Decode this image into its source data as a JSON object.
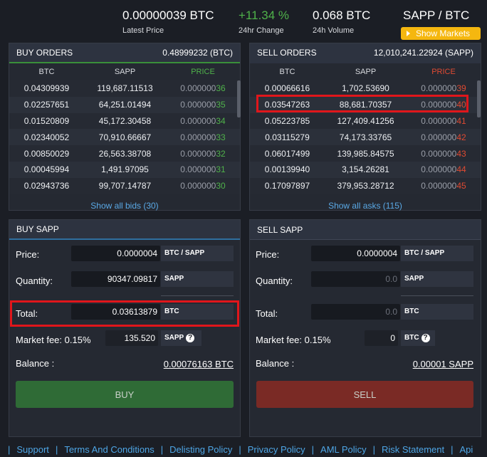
{
  "ticker": {
    "latest_price": "0.00000039 BTC",
    "latest_price_label": "Latest Price",
    "change": "+11.34 %",
    "change_label": "24hr Change",
    "volume": "0.068 BTC",
    "volume_label": "24h Volume",
    "pair": "SAPP / BTC",
    "show_markets": "Show Markets"
  },
  "buy_orders": {
    "title": "BUY ORDERS",
    "total": "0.48999232 (BTC)",
    "columns": [
      "BTC",
      "SAPP",
      "PRICE"
    ],
    "rows": [
      {
        "btc": "0.04309939",
        "sapp": "119,687.11513",
        "price_dim": "0.000000",
        "price_hl": "36"
      },
      {
        "btc": "0.02257651",
        "sapp": "64,251.01494",
        "price_dim": "0.000000",
        "price_hl": "35"
      },
      {
        "btc": "0.01520809",
        "sapp": "45,172.30458",
        "price_dim": "0.000000",
        "price_hl": "34"
      },
      {
        "btc": "0.02340052",
        "sapp": "70,910.66667",
        "price_dim": "0.000000",
        "price_hl": "33"
      },
      {
        "btc": "0.00850029",
        "sapp": "26,563.38708",
        "price_dim": "0.000000",
        "price_hl": "32"
      },
      {
        "btc": "0.00045994",
        "sapp": "1,491.97095",
        "price_dim": "0.000000",
        "price_hl": "31"
      },
      {
        "btc": "0.02943736",
        "sapp": "99,707.14787",
        "price_dim": "0.000000",
        "price_hl": "30"
      }
    ],
    "show_all": "Show all bids (30)",
    "accent": "#4fb24a"
  },
  "sell_orders": {
    "title": "SELL ORDERS",
    "total": "12,010,241.22924 (SAPP)",
    "columns": [
      "BTC",
      "SAPP",
      "PRICE"
    ],
    "rows": [
      {
        "btc": "0.00066616",
        "sapp": "1,702.53690",
        "price_dim": "0.000000",
        "price_hl": "39"
      },
      {
        "btc": "0.03547263",
        "sapp": "88,681.70357",
        "price_dim": "0.000000",
        "price_hl": "40"
      },
      {
        "btc": "0.05223785",
        "sapp": "127,409.41256",
        "price_dim": "0.000000",
        "price_hl": "41"
      },
      {
        "btc": "0.03115279",
        "sapp": "74,173.33765",
        "price_dim": "0.000000",
        "price_hl": "42"
      },
      {
        "btc": "0.06017499",
        "sapp": "139,985.84575",
        "price_dim": "0.000000",
        "price_hl": "43"
      },
      {
        "btc": "0.00139940",
        "sapp": "3,154.26281",
        "price_dim": "0.000000",
        "price_hl": "44"
      },
      {
        "btc": "0.17097897",
        "sapp": "379,953.28712",
        "price_dim": "0.000000",
        "price_hl": "45"
      }
    ],
    "show_all": "Show all asks (115)",
    "accent": "#e04a32"
  },
  "buy_form": {
    "title": "BUY SAPP",
    "price_label": "Price:",
    "price_value": "0.0000004",
    "price_unit": "BTC / SAPP",
    "quantity_label": "Quantity:",
    "quantity_value": "90347.09817",
    "quantity_unit": "SAPP",
    "total_label": "Total:",
    "total_value": "0.03613879",
    "total_unit": "BTC",
    "fee_label": "Market fee: 0.15%",
    "fee_value": "135.520",
    "fee_unit": "SAPP",
    "balance_label": "Balance :",
    "balance_value": "0.00076163 BTC",
    "button": "BUY"
  },
  "sell_form": {
    "title": "SELL SAPP",
    "price_label": "Price:",
    "price_value": "0.0000004",
    "price_unit": "BTC / SAPP",
    "quantity_label": "Quantity:",
    "quantity_placeholder": "0.0",
    "quantity_unit": "SAPP",
    "total_label": "Total:",
    "total_placeholder": "0.0",
    "total_unit": "BTC",
    "fee_label": "Market fee: 0.15%",
    "fee_value": "0",
    "fee_unit": "BTC",
    "balance_label": "Balance :",
    "balance_value": "0.00001 SAPP",
    "button": "SELL"
  },
  "footer": {
    "links": [
      "Support",
      "Terms And Conditions",
      "Delisting Policy",
      "Privacy Policy",
      "AML Policy",
      "Risk Statement",
      "Api"
    ]
  },
  "colors": {
    "buy_button": "#2f6b36",
    "sell_button": "#7a2a25",
    "highlight": "#e0161b"
  }
}
